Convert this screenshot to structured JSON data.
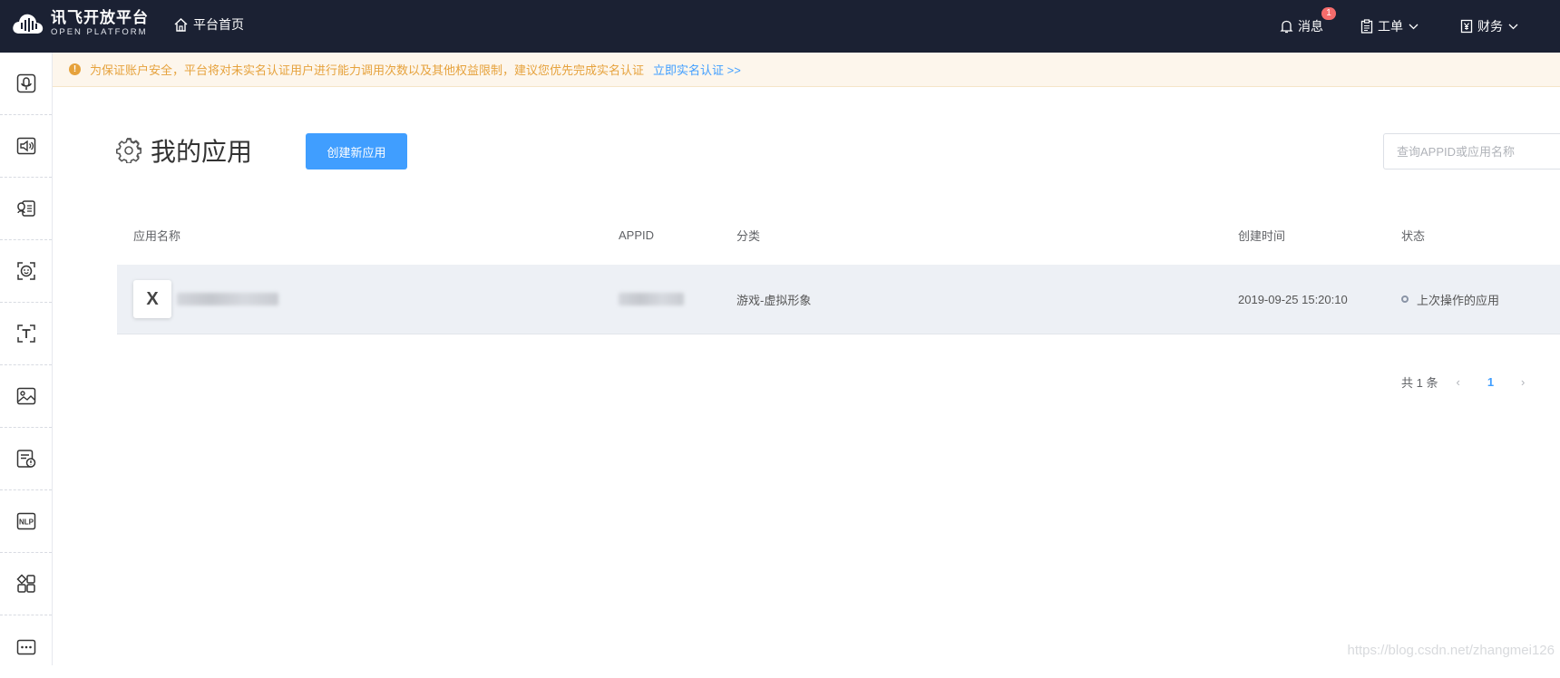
{
  "topbar": {
    "logo_cn": "讯飞开放平台",
    "logo_en": "OPEN PLATFORM",
    "home_label": "平台首页",
    "messages_label": "消息",
    "messages_badge": "1",
    "tickets_label": "工单",
    "finance_label": "财务"
  },
  "sidebar": {
    "items": [
      "voice-recognition-icon",
      "speech-synthesis-icon",
      "voice-card-icon",
      "face-icon",
      "text-icon",
      "image-icon",
      "doc-scan-icon",
      "nlp-icon",
      "apps-grid-icon",
      "more-icon"
    ],
    "nlp_text": "NLP"
  },
  "notice": {
    "text": "为保证账户安全，平台将对未实名认证用户进行能力调用次数以及其他权益限制，建议您优先完成实名认证",
    "link": "立即实名认证 >>",
    "icon": "!"
  },
  "header": {
    "title": "我的应用",
    "create_button": "创建新应用",
    "search_placeholder": "查询APPID或应用名称"
  },
  "table": {
    "columns": [
      "应用名称",
      "APPID",
      "分类",
      "创建时间",
      "状态"
    ],
    "rows": [
      {
        "avatar": "X",
        "category": "游戏-虚拟形象",
        "created": "2019-09-25 15:20:10",
        "status": "上次操作的应用"
      }
    ]
  },
  "pagination": {
    "total": "共 1 条",
    "current": "1",
    "prev": "‹",
    "next": "›"
  },
  "watermark": "https://blog.csdn.net/zhangmei126",
  "colors": {
    "topbar": "#1b2133",
    "primary": "#409eff",
    "warning": "#e6a23c",
    "badge": "#f56c6c"
  }
}
